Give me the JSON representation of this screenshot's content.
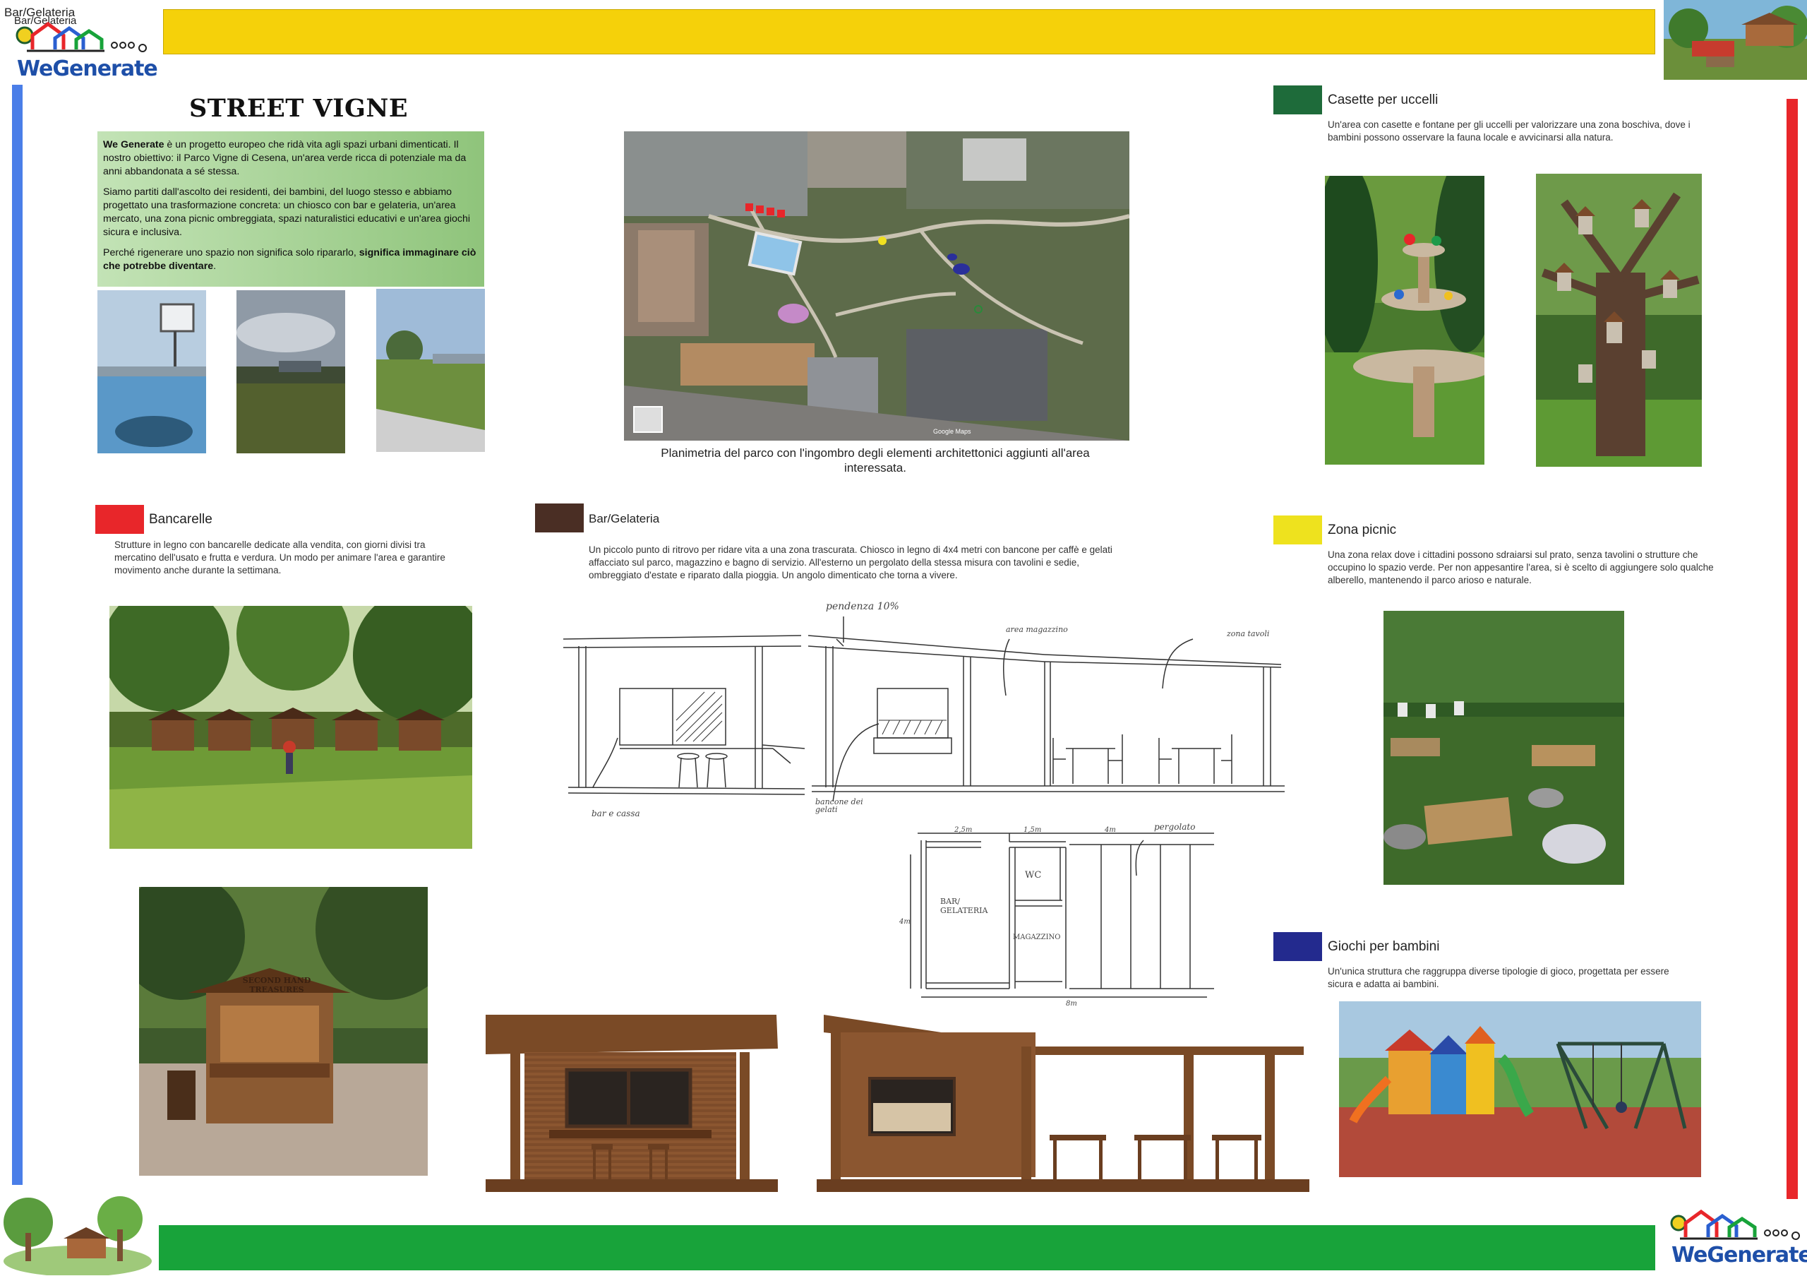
{
  "header": {
    "corner_label_1": "Bar/Gelateria",
    "corner_label_2": "Bar/Gelateria",
    "logo_text_we": "We",
    "logo_text_generate": "Generate",
    "top_bar_color": "#f5d10a",
    "bottom_bar_color": "#18a33a"
  },
  "title": "STREET VIGNE",
  "intro": {
    "p1_bold": "We Generate",
    "p1": " è un progetto europeo che ridà vita agli spazi urbani dimenticati. Il nostro obiettivo: il Parco Vigne di Cesena, un'area verde ricca di potenziale ma da anni abbandonata a sé stessa.",
    "p2": "Siamo partiti dall'ascolto dei residenti, dei bambini, del luogo stesso e abbiamo progettato una trasformazione concreta: un chiosco con bar e gelateria, un'area mercato, una zona picnic ombreggiata, spazi naturalistici educativi e un'area giochi sicura e inclusiva.",
    "p3": "Perché rigenerare uno spazio non significa solo ripararlo, ",
    "p3_bold": "significa immaginare ciò che potrebbe diventare",
    "p3_end": "."
  },
  "map": {
    "caption": "Planimetria del parco con l'ingombro degli elementi architettonici aggiunti all'area interessata.",
    "attribution": "Google Maps"
  },
  "sections": {
    "bancarelle": {
      "title": "Bancarelle",
      "color": "#e8262a",
      "text": "Strutture in legno con bancarelle dedicate alla vendita, con giorni divisi tra mercatino dell'usato e frutta e verdura. Un modo per animare l'area e garantire movimento anche durante la settimana."
    },
    "bar": {
      "title": "Bar/Gelateria",
      "color": "#4a2e24",
      "text": "Un piccolo punto di ritrovo per ridare vita a una zona trascurata. Chiosco in legno di 4x4 metri con bancone per caffè e gelati affacciato sul parco, magazzino e bagno di servizio. All'esterno un pergolato della stessa misura con tavolini e sedie, ombreggiato d'estate e riparato dalla pioggia. Un angolo dimenticato che torna a vivere."
    },
    "uccelli": {
      "title": "Casette per uccelli",
      "color": "#1e6b3a",
      "text": "Un'area con casette e fontane per gli uccelli per valorizzare una zona boschiva, dove i bambini possono osservare la fauna locale e avvicinarsi alla natura."
    },
    "picnic": {
      "title": "Zona picnic",
      "color": "#eee21e",
      "text": "Una zona relax dove i cittadini possono sdraiarsi sul prato, senza tavolini o strutture che occupino lo spazio verde. Per non appesantire l'area, si è scelto di aggiungere solo qualche alberello, mantenendo il parco arioso e naturale."
    },
    "giochi": {
      "title": "Giochi per bambini",
      "color": "#232a8e",
      "text": "Un'unica struttura che raggruppa diverse tipologie di gioco, progettata per essere sicura e adatta ai bambini."
    }
  },
  "sketch": {
    "pendenza": "pendenza 10%",
    "area_magazzino": "area magazzino",
    "zona_tavoli": "zona tavoli",
    "bar_cassa": "bar e cassa",
    "bancone_gelati": "bancone dei gelati",
    "pergolato": "pergolato",
    "dim_25": "2,5m",
    "dim_15": "1,5m",
    "dim_4a": "4m",
    "dim_4b": "4m",
    "dim_8": "8m",
    "wc": "WC",
    "bar_gelateria": "BAR/ GELATERIA",
    "magazzino": "MAGAZZINO"
  },
  "kiosk_sign": "SECOND HAND TREASURES"
}
